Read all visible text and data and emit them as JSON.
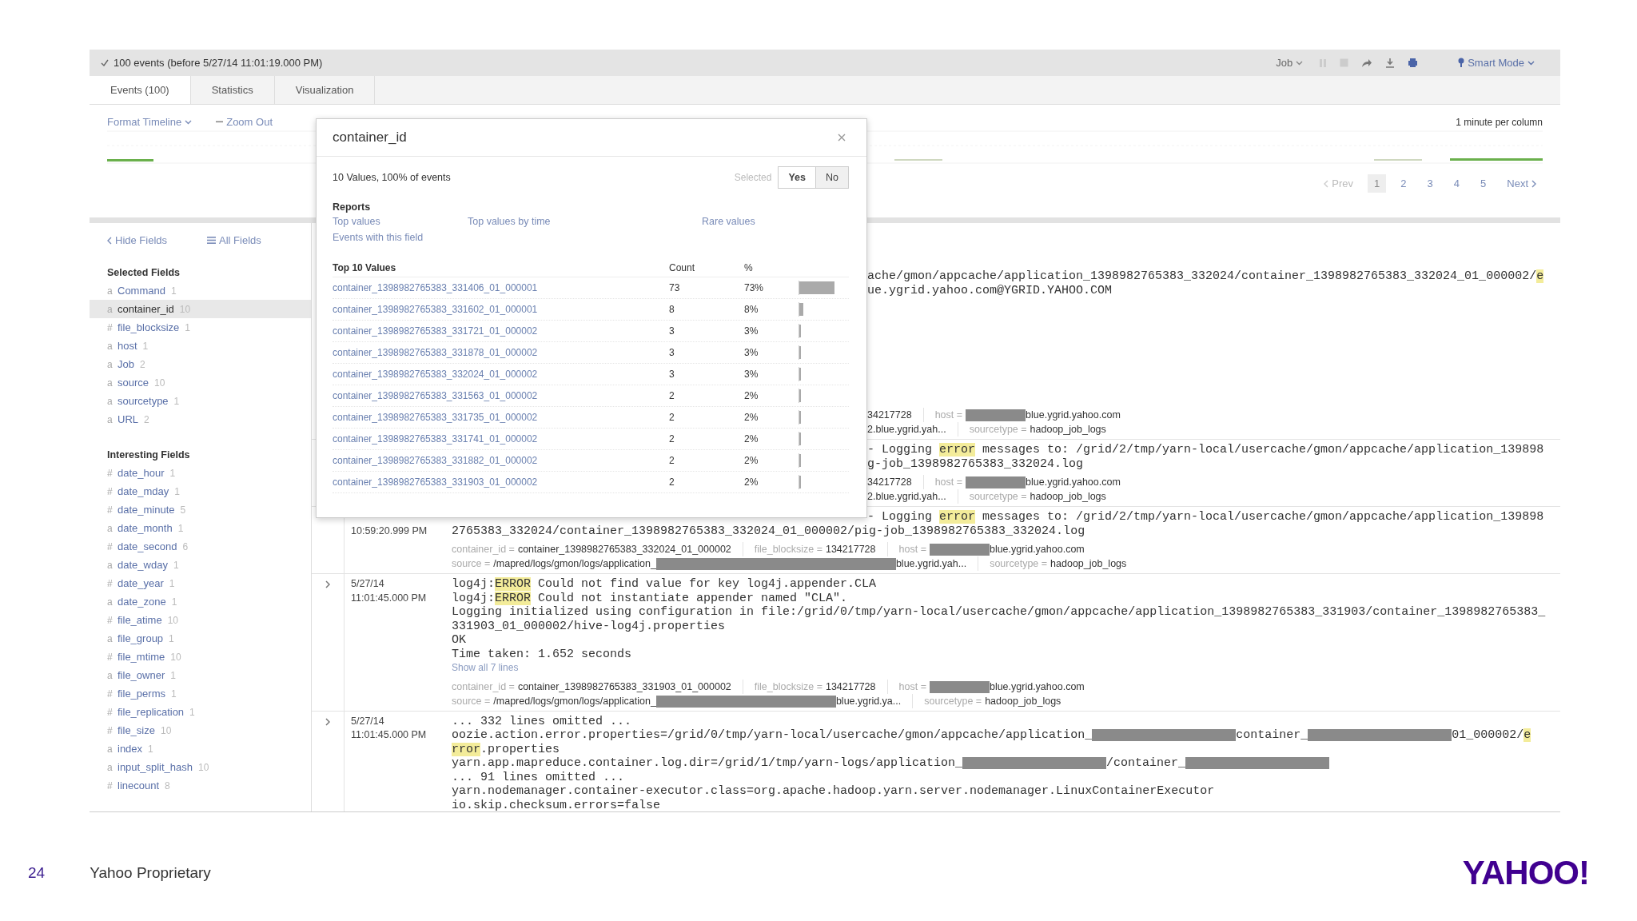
{
  "job_bar": {
    "status": "100 events (before 5/27/14 11:01:19.000 PM)",
    "job_menu": "Job",
    "mode_menu": "Smart Mode"
  },
  "tabs": [
    {
      "label": "Events (100)",
      "selected": true
    },
    {
      "label": "Statistics",
      "selected": false
    },
    {
      "label": "Visualization",
      "selected": false
    }
  ],
  "timeline": {
    "format_menu": "Format Timeline",
    "zoom_out": "Zoom Out",
    "scale": "1 minute per column"
  },
  "pagination": {
    "prev": "Prev",
    "prev_disabled": true,
    "pages": [
      {
        "label": "1",
        "selected": true
      },
      {
        "label": "2",
        "selected": false
      },
      {
        "label": "3",
        "selected": false
      },
      {
        "label": "4",
        "selected": false
      },
      {
        "label": "5",
        "selected": false
      }
    ],
    "next": "Next"
  },
  "sidebar": {
    "hide_fields": "Hide Fields",
    "all_fields": "All Fields",
    "groups": [
      {
        "title": "Selected Fields",
        "fields": [
          {
            "type": "a",
            "name": "Command",
            "count": "1",
            "selected": false
          },
          {
            "type": "a",
            "name": "container_id",
            "count": "10",
            "selected": true
          },
          {
            "type": "#",
            "name": "file_blocksize",
            "count": "1",
            "selected": false
          },
          {
            "type": "a",
            "name": "host",
            "count": "1",
            "selected": false
          },
          {
            "type": "a",
            "name": "Job",
            "count": "2",
            "selected": false
          },
          {
            "type": "a",
            "name": "source",
            "count": "10",
            "selected": false
          },
          {
            "type": "a",
            "name": "sourcetype",
            "count": "1",
            "selected": false
          },
          {
            "type": "a",
            "name": "URL",
            "count": "2",
            "selected": false
          }
        ]
      },
      {
        "title": "Interesting Fields",
        "fields": [
          {
            "type": "#",
            "name": "date_hour",
            "count": "1",
            "selected": false
          },
          {
            "type": "#",
            "name": "date_mday",
            "count": "1",
            "selected": false
          },
          {
            "type": "#",
            "name": "date_minute",
            "count": "5",
            "selected": false
          },
          {
            "type": "a",
            "name": "date_month",
            "count": "1",
            "selected": false
          },
          {
            "type": "#",
            "name": "date_second",
            "count": "6",
            "selected": false
          },
          {
            "type": "a",
            "name": "date_wday",
            "count": "1",
            "selected": false
          },
          {
            "type": "#",
            "name": "date_year",
            "count": "1",
            "selected": false
          },
          {
            "type": "a",
            "name": "date_zone",
            "count": "1",
            "selected": false
          },
          {
            "type": "#",
            "name": "file_atime",
            "count": "10",
            "selected": false
          },
          {
            "type": "a",
            "name": "file_group",
            "count": "1",
            "selected": false
          },
          {
            "type": "#",
            "name": "file_mtime",
            "count": "10",
            "selected": false
          },
          {
            "type": "a",
            "name": "file_owner",
            "count": "1",
            "selected": false
          },
          {
            "type": "#",
            "name": "file_perms",
            "count": "1",
            "selected": false
          },
          {
            "type": "#",
            "name": "file_replication",
            "count": "1",
            "selected": false
          },
          {
            "type": "#",
            "name": "file_size",
            "count": "10",
            "selected": false
          },
          {
            "type": "a",
            "name": "index",
            "count": "1",
            "selected": false
          },
          {
            "type": "a",
            "name": "input_split_hash",
            "count": "10",
            "selected": false
          },
          {
            "type": "#",
            "name": "linecount",
            "count": "8",
            "selected": false
          }
        ]
      }
    ]
  },
  "field_popup": {
    "title": "container_id",
    "summary": "10 Values, 100% of events",
    "selected_label": "Selected",
    "selected_options": [
      {
        "label": "Yes",
        "selected": true
      },
      {
        "label": "No",
        "selected": false
      }
    ],
    "reports_title": "Reports",
    "reports": [
      "Top values",
      "Top values by time",
      "Rare values",
      "Events with this field"
    ],
    "table": {
      "columns": [
        "Top 10 Values",
        "Count",
        "%"
      ],
      "rows": [
        {
          "value": "container_1398982765383_331406_01_000001",
          "count": "73",
          "percent": "73%",
          "level": 0.73
        },
        {
          "value": "container_1398982765383_331602_01_000001",
          "count": "8",
          "percent": "8%",
          "level": 0.08
        },
        {
          "value": "container_1398982765383_331721_01_000002",
          "count": "3",
          "percent": "3%",
          "level": 0.03
        },
        {
          "value": "container_1398982765383_331878_01_000002",
          "count": "3",
          "percent": "3%",
          "level": 0.03
        },
        {
          "value": "container_1398982765383_332024_01_000002",
          "count": "3",
          "percent": "3%",
          "level": 0.03
        },
        {
          "value": "container_1398982765383_331563_01_000002",
          "count": "2",
          "percent": "2%",
          "level": 0.02
        },
        {
          "value": "container_1398982765383_331735_01_000002",
          "count": "2",
          "percent": "2%",
          "level": 0.02
        },
        {
          "value": "container_1398982765383_331741_01_000002",
          "count": "2",
          "percent": "2%",
          "level": 0.02
        },
        {
          "value": "container_1398982765383_331882_01_000002",
          "count": "2",
          "percent": "2%",
          "level": 0.02
        },
        {
          "value": "container_1398982765383_331903_01_000002",
          "count": "2",
          "percent": "2%",
          "level": 0.02
        }
      ]
    }
  },
  "events": [
    {
      "chevron": false,
      "lines": [
        {
          "covered": true,
          "parts": [
            {
              "kind": "text",
              "text": "ache/gmon/appcache/application_1398982765383_332024/container_1398982765383_332024_01_000002/"
            },
            {
              "kind": "mark",
              "text": "e"
            }
          ]
        },
        {
          "covered": true,
          "parts": [
            {
              "kind": "text",
              "text": "ue.ygrid.yahoo.com@YGRID.YAHOO.COM"
            }
          ]
        }
      ],
      "fields": [
        {
          "covered": true,
          "items": [
            {
              "parts": [
                {
                  "kind": "text",
                  "text": "34217728"
                }
              ]
            },
            {
              "parts": [
                {
                  "kind": "key",
                  "text": "host ="
                },
                {
                  "kind": "redacted"
                },
                {
                  "kind": "text",
                  "text": "blue.ygrid.yahoo.com"
                }
              ]
            }
          ]
        },
        {
          "covered": true,
          "items": [
            {
              "parts": [
                {
                  "kind": "text",
                  "text": "2.blue.ygrid.yah..."
                }
              ]
            },
            {
              "parts": [
                {
                  "kind": "key",
                  "text": "sourcetype ="
                },
                {
                  "kind": "text",
                  "text": "hadoop_job_logs"
                }
              ]
            }
          ]
        }
      ]
    },
    {
      "chevron": false,
      "lines": [
        {
          "covered": true,
          "parts": [
            {
              "kind": "text",
              "text": "- Logging "
            },
            {
              "kind": "mark",
              "text": "error"
            },
            {
              "kind": "text",
              "text": " messages to: /grid/2/tmp/yarn-local/usercache/gmon/appcache/application_139898"
            }
          ]
        },
        {
          "covered": true,
          "parts": [
            {
              "kind": "text",
              "text": "g-job_1398982765383_332024.log"
            }
          ]
        }
      ],
      "fields": [
        {
          "covered": true,
          "items": [
            {
              "parts": [
                {
                  "kind": "text",
                  "text": "34217728"
                }
              ]
            },
            {
              "parts": [
                {
                  "kind": "key",
                  "text": "host ="
                },
                {
                  "kind": "redacted"
                },
                {
                  "kind": "text",
                  "text": "blue.ygrid.yahoo.com"
                }
              ]
            }
          ]
        },
        {
          "covered": true,
          "items": [
            {
              "parts": [
                {
                  "kind": "text",
                  "text": "2.blue.ygrid.yah..."
                }
              ]
            },
            {
              "parts": [
                {
                  "kind": "key",
                  "text": "sourcetype ="
                },
                {
                  "kind": "text",
                  "text": "hadoop_job_logs"
                }
              ]
            }
          ]
        }
      ]
    },
    {
      "chevron": false,
      "time": "10:59:20.999 PM",
      "lines": [
        {
          "covered": true,
          "parts": [
            {
              "kind": "text",
              "text": "- Logging "
            },
            {
              "kind": "mark",
              "text": "error"
            },
            {
              "kind": "text",
              "text": " messages to: /grid/2/tmp/yarn-local/usercache/gmon/appcache/application_139898"
            }
          ]
        },
        {
          "parts": [
            {
              "kind": "text",
              "text": "2765383_332024/container_1398982765383_332024_01_000002/pig-job_1398982765383_332024.log"
            }
          ]
        }
      ],
      "fields": [
        {
          "items": [
            {
              "parts": [
                {
                  "kind": "key",
                  "text": "container_id ="
                },
                {
                  "kind": "text",
                  "text": "container_1398982765383_332024_01_000002"
                }
              ]
            },
            {
              "parts": [
                {
                  "kind": "key",
                  "text": "file_blocksize ="
                },
                {
                  "kind": "text",
                  "text": "134217728"
                }
              ]
            },
            {
              "parts": [
                {
                  "kind": "key",
                  "text": "host ="
                },
                {
                  "kind": "redacted"
                },
                {
                  "kind": "text",
                  "text": "blue.ygrid.yahoo.com"
                }
              ]
            }
          ]
        },
        {
          "items": [
            {
              "parts": [
                {
                  "kind": "key",
                  "text": "source ="
                },
                {
                  "kind": "text",
                  "text": "/mapred/logs/gmon/logs/application_"
                },
                {
                  "kind": "redacted"
                },
                {
                  "kind": "redacted"
                },
                {
                  "kind": "text",
                  "text": "blue.ygrid.yah..."
                }
              ]
            },
            {
              "parts": [
                {
                  "kind": "key",
                  "text": "sourcetype ="
                },
                {
                  "kind": "text",
                  "text": "hadoop_job_logs"
                }
              ]
            }
          ]
        }
      ]
    },
    {
      "chevron": true,
      "date": "5/27/14",
      "time": "11:01:45.000 PM",
      "lines": [
        {
          "parts": [
            {
              "kind": "text",
              "text": "log4j:"
            },
            {
              "kind": "mark",
              "text": "ERROR"
            },
            {
              "kind": "text",
              "text": " Could not find value for key log4j.appender.CLA"
            }
          ]
        },
        {
          "parts": [
            {
              "kind": "text",
              "text": "log4j:"
            },
            {
              "kind": "mark",
              "text": "ERROR"
            },
            {
              "kind": "text",
              "text": " Could not instantiate appender named \"CLA\"."
            }
          ]
        },
        {
          "parts": [
            {
              "kind": "text",
              "text": "Logging initialized using configuration in file:/grid/0/tmp/yarn-local/usercache/gmon/appcache/application_1398982765383_331903/container_1398982765383_"
            }
          ]
        },
        {
          "parts": [
            {
              "kind": "text",
              "text": "331903_01_000002/hive-log4j.properties"
            }
          ]
        },
        {
          "parts": [
            {
              "kind": "text",
              "text": "OK"
            }
          ]
        },
        {
          "parts": [
            {
              "kind": "text",
              "text": "Time taken: 1.652 seconds"
            }
          ]
        }
      ],
      "show_all": "Show all 7 lines",
      "fields": [
        {
          "items": [
            {
              "parts": [
                {
                  "kind": "key",
                  "text": "container_id ="
                },
                {
                  "kind": "text",
                  "text": "container_1398982765383_331903_01_000002"
                }
              ]
            },
            {
              "parts": [
                {
                  "kind": "key",
                  "text": "file_blocksize ="
                },
                {
                  "kind": "text",
                  "text": "134217728"
                }
              ]
            },
            {
              "parts": [
                {
                  "kind": "key",
                  "text": "host ="
                },
                {
                  "kind": "redacted"
                },
                {
                  "kind": "text",
                  "text": "blue.ygrid.yahoo.com"
                }
              ]
            }
          ]
        },
        {
          "items": [
            {
              "parts": [
                {
                  "kind": "key",
                  "text": "source ="
                },
                {
                  "kind": "text",
                  "text": "/mapred/logs/gmon/logs/application_"
                },
                {
                  "kind": "redacted"
                },
                {
                  "kind": "text",
                  "text": "blue.ygrid.ya..."
                }
              ]
            },
            {
              "parts": [
                {
                  "kind": "key",
                  "text": "sourcetype ="
                },
                {
                  "kind": "text",
                  "text": "hadoop_job_logs"
                }
              ]
            }
          ]
        }
      ]
    },
    {
      "chevron": true,
      "date": "5/27/14",
      "time": "11:01:45.000 PM",
      "lines": [
        {
          "parts": [
            {
              "kind": "text",
              "text": "... 332 lines omitted ..."
            }
          ]
        },
        {
          "parts": [
            {
              "kind": "text",
              "text": "oozie.action.error.properties=/grid/0/tmp/yarn-local/usercache/gmon/appcache/application_"
            },
            {
              "kind": "redacted"
            },
            {
              "kind": "text",
              "text": "container_"
            },
            {
              "kind": "redacted"
            },
            {
              "kind": "text",
              "text": "01_000002/"
            },
            {
              "kind": "mark",
              "text": "e"
            }
          ]
        },
        {
          "parts": [
            {
              "kind": "mark",
              "text": "rror"
            },
            {
              "kind": "text",
              "text": ".properties"
            }
          ]
        },
        {
          "parts": [
            {
              "kind": "text",
              "text": "yarn.app.mapreduce.container.log.dir=/grid/1/tmp/yarn-logs/application_"
            },
            {
              "kind": "redacted"
            },
            {
              "kind": "text",
              "text": "/container_"
            },
            {
              "kind": "redacted"
            }
          ]
        },
        {
          "parts": [
            {
              "kind": "text",
              "text": "... 91 lines omitted ..."
            }
          ]
        },
        {
          "parts": [
            {
              "kind": "text",
              "text": "yarn.nodemanager.container-executor.class=org.apache.hadoop.yarn.server.nodemanager.LinuxContainerExecutor"
            }
          ]
        },
        {
          "parts": [
            {
              "kind": "text",
              "text": "io.skip.checksum.errors=false"
            }
          ]
        }
      ]
    }
  ],
  "footer": {
    "page_number": "24",
    "label": "Yahoo Proprietary",
    "logo": "YAHOO!"
  }
}
